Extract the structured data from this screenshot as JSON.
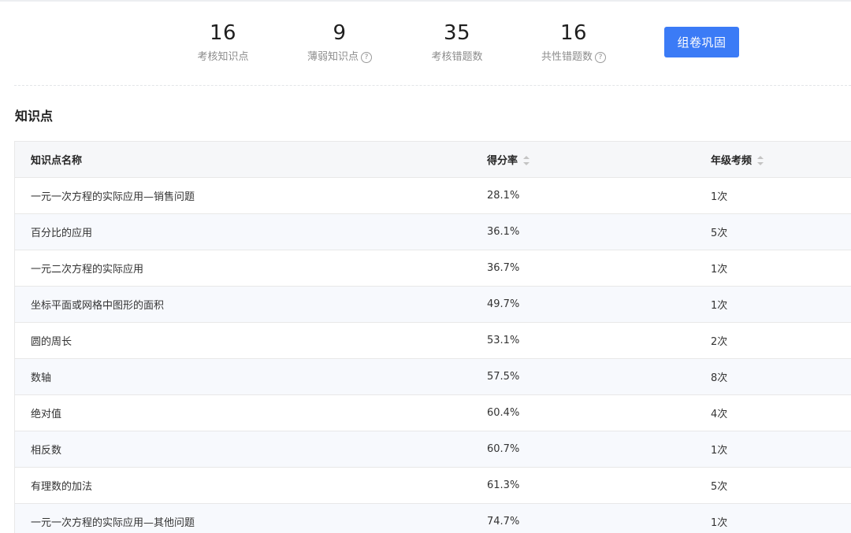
{
  "stats": [
    {
      "value": "16",
      "label": "考核知识点",
      "help": false
    },
    {
      "value": "9",
      "label": "薄弱知识点",
      "help": true
    },
    {
      "value": "35",
      "label": "考核错题数",
      "help": false
    },
    {
      "value": "16",
      "label": "共性错题数",
      "help": true
    }
  ],
  "actions": {
    "compose_label": "组卷巩固"
  },
  "help_icon": "?",
  "section": {
    "title": "知识点"
  },
  "table": {
    "headers": {
      "name": "知识点名称",
      "score": "得分率",
      "freq": "年级考频"
    },
    "rows": [
      {
        "name": "一元一次方程的实际应用—销售问题",
        "score": "28.1%",
        "freq": "1次"
      },
      {
        "name": "百分比的应用",
        "score": "36.1%",
        "freq": "5次"
      },
      {
        "name": "一元二次方程的实际应用",
        "score": "36.7%",
        "freq": "1次"
      },
      {
        "name": "坐标平面或网格中图形的面积",
        "score": "49.7%",
        "freq": "1次"
      },
      {
        "name": "圆的周长",
        "score": "53.1%",
        "freq": "2次"
      },
      {
        "name": "数轴",
        "score": "57.5%",
        "freq": "8次"
      },
      {
        "name": "绝对值",
        "score": "60.4%",
        "freq": "4次"
      },
      {
        "name": "相反数",
        "score": "60.7%",
        "freq": "1次"
      },
      {
        "name": "有理数的加法",
        "score": "61.3%",
        "freq": "5次"
      },
      {
        "name": "一元一次方程的实际应用—其他问题",
        "score": "74.7%",
        "freq": "1次"
      }
    ]
  },
  "colors": {
    "primary": "#3b7bf6",
    "alt_row": "#f7f9fd",
    "header_bg": "#f6f7f9"
  }
}
